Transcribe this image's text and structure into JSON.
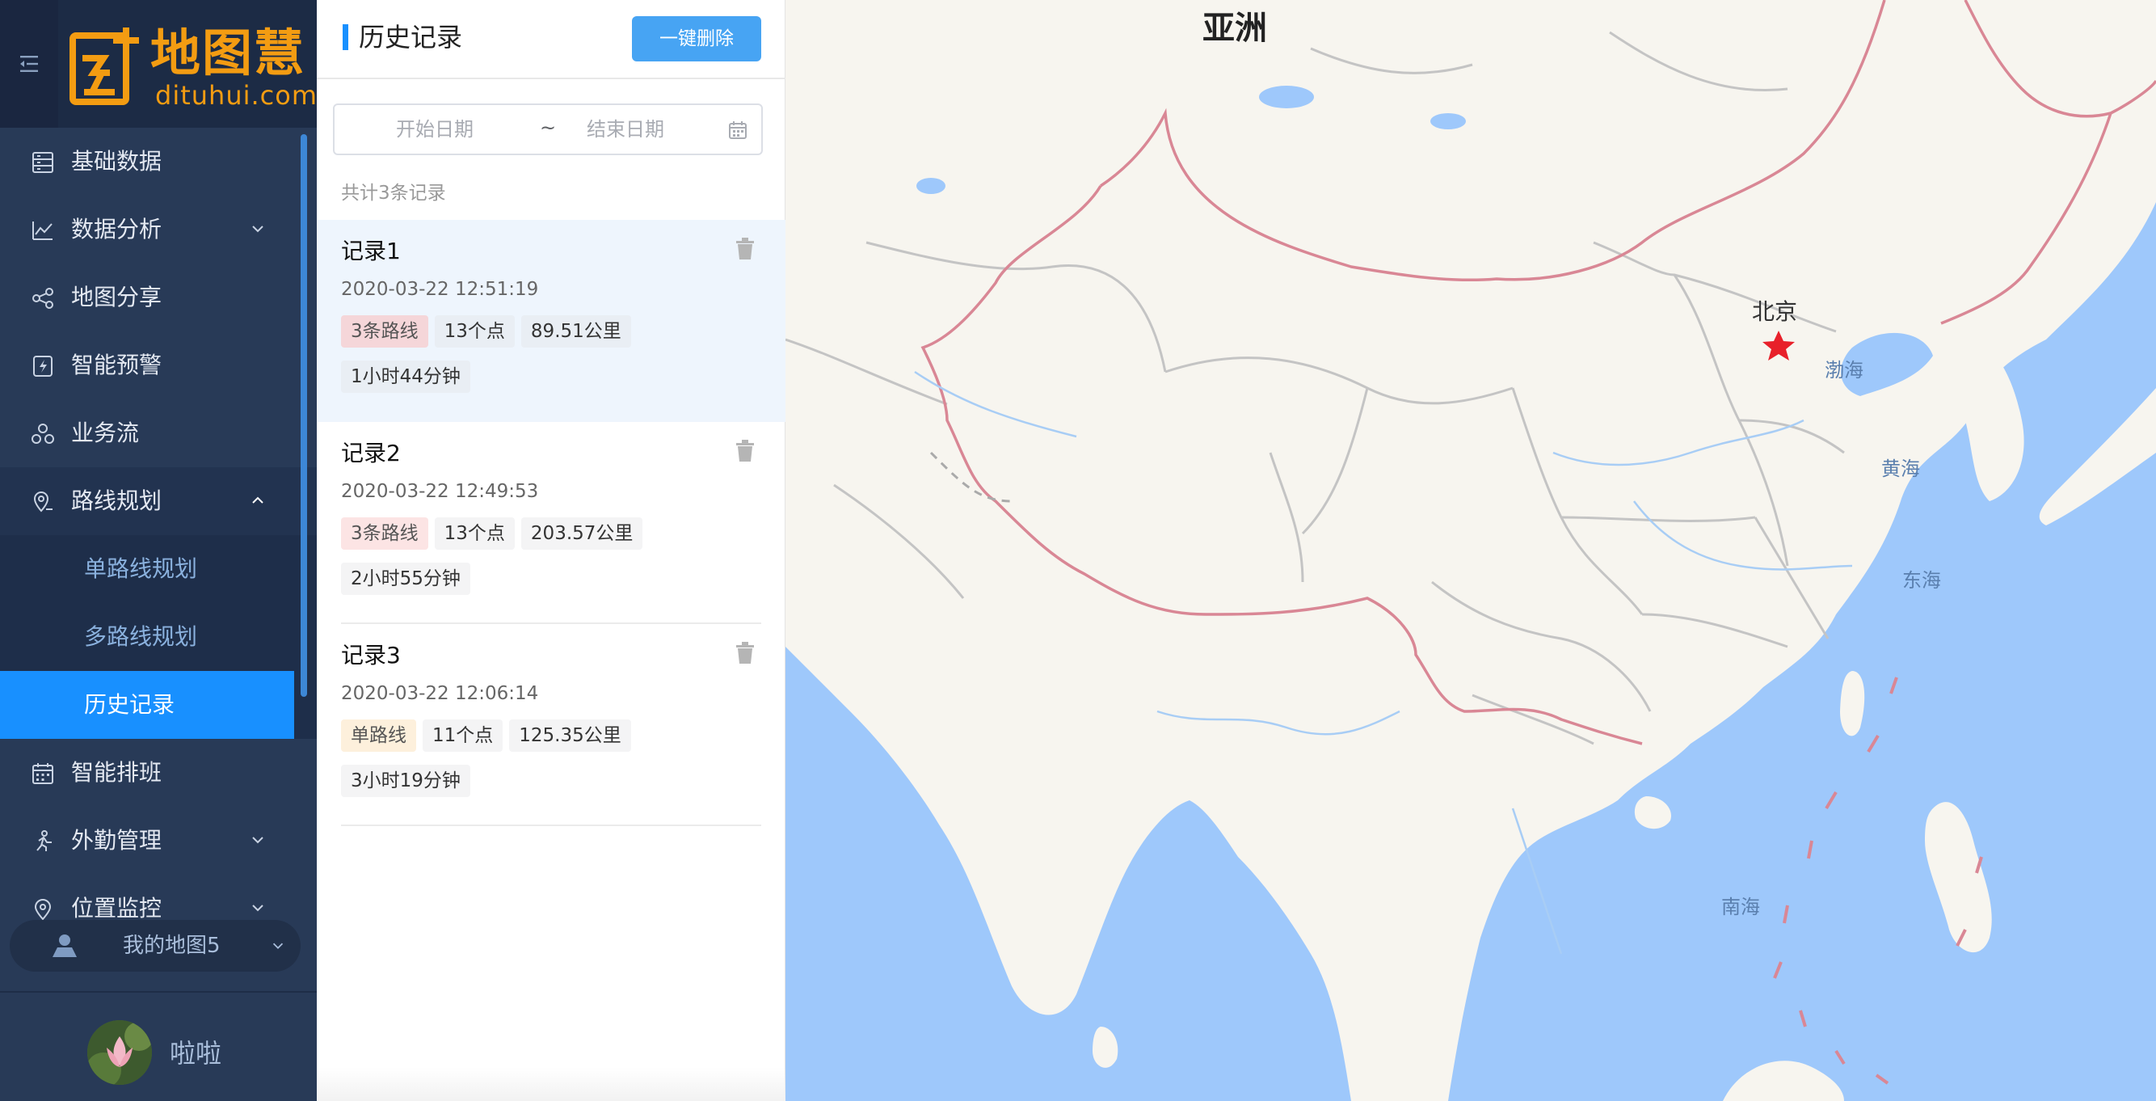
{
  "app": {
    "logo_cn": "地图慧",
    "logo_en": "dituhui.com"
  },
  "sidebar": {
    "items": [
      {
        "label": "基础数据",
        "icon": "database-icon"
      },
      {
        "label": "数据分析",
        "icon": "analysis-icon",
        "expandable": true
      },
      {
        "label": "地图分享",
        "icon": "share-icon"
      },
      {
        "label": "智能预警",
        "icon": "alert-icon"
      },
      {
        "label": "业务流",
        "icon": "workflow-icon"
      },
      {
        "label": "路线规划",
        "icon": "route-icon",
        "expanded": true,
        "children": [
          {
            "label": "单路线规划"
          },
          {
            "label": "多路线规划"
          },
          {
            "label": "历史记录",
            "active": true
          }
        ]
      },
      {
        "label": "智能排班",
        "icon": "calendar-icon"
      },
      {
        "label": "外勤管理",
        "icon": "field-icon",
        "expandable": true
      },
      {
        "label": "位置监控",
        "icon": "location-icon",
        "expandable": true
      }
    ],
    "map_selector": "我的地图5",
    "user_name": "啦啦"
  },
  "panel": {
    "title": "历史记录",
    "clear_all": "一键删除",
    "date_start_placeholder": "开始日期",
    "date_separator": "~",
    "date_end_placeholder": "结束日期",
    "record_count": "共计3条记录",
    "records": [
      {
        "name": "记录1",
        "time": "2020-03-22 12:51:19",
        "routes": "3条路线",
        "points": "13个点",
        "distance": "89.51公里",
        "duration": "1小时44分钟",
        "selected": true
      },
      {
        "name": "记录2",
        "time": "2020-03-22 12:49:53",
        "routes": "3条路线",
        "points": "13个点",
        "distance": "203.57公里",
        "duration": "2小时55分钟"
      },
      {
        "name": "记录3",
        "time": "2020-03-22 12:06:14",
        "routes": "单路线",
        "points": "11个点",
        "distance": "125.35公里",
        "duration": "3小时19分钟"
      }
    ]
  },
  "map": {
    "labels": {
      "continent": "亚洲",
      "capital": "北京",
      "bohai": "渤海",
      "yellow_sea": "黄海",
      "east_sea": "东海",
      "south_sea": "南海"
    },
    "colors": {
      "water": "#9ec8fb",
      "land": "#f7f5ef",
      "border": "#d98795",
      "marker": "#e8202a"
    }
  }
}
